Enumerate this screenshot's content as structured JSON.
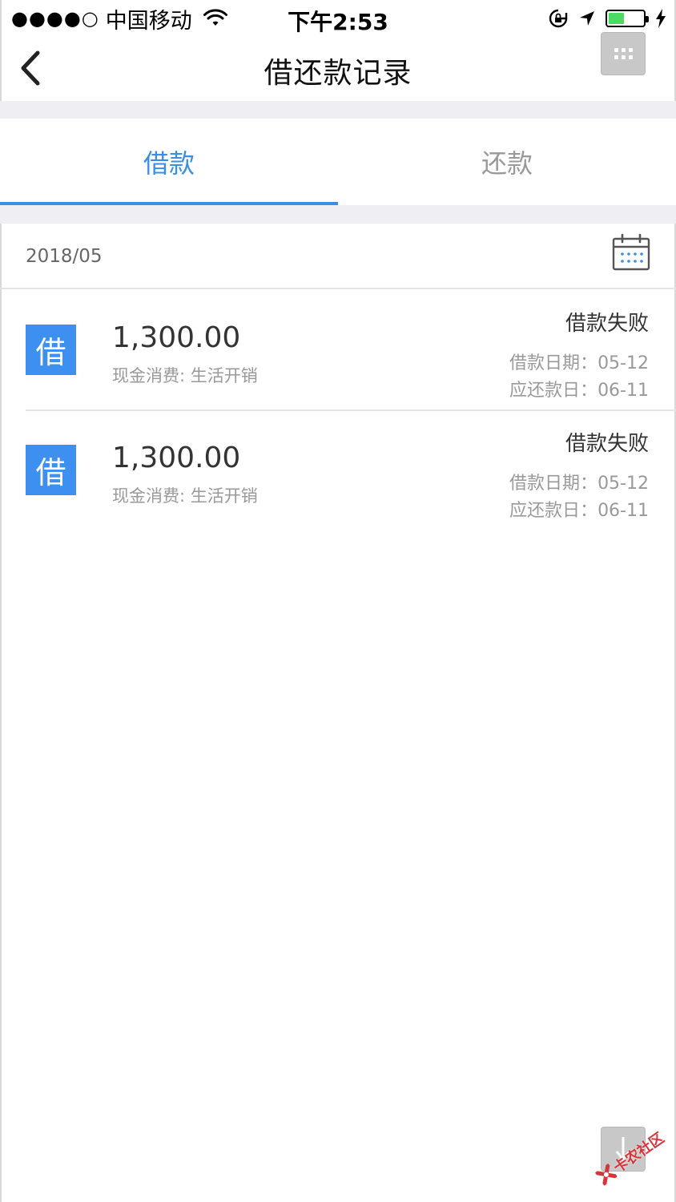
{
  "status_bar": {
    "signal": "●●●●○",
    "carrier": "中国移动",
    "time": "下午2:53",
    "battery_level": 0.45
  },
  "nav": {
    "title": "借还款记录"
  },
  "tabs": [
    {
      "label": "借款",
      "active": true
    },
    {
      "label": "还款",
      "active": false
    }
  ],
  "month": {
    "label": "2018/05"
  },
  "records": [
    {
      "badge": "借",
      "amount": "1,300.00",
      "description": "现金消费: 生活开销",
      "status": "借款失败",
      "loan_date_label": "借款日期：",
      "loan_date": "05-12",
      "due_date_label": "应还款日：",
      "due_date": "06-11"
    },
    {
      "badge": "借",
      "amount": "1,300.00",
      "description": "现金消费: 生活开销",
      "status": "借款失败",
      "loan_date_label": "借款日期：",
      "loan_date": "05-12",
      "due_date_label": "应还款日：",
      "due_date": "06-11"
    }
  ],
  "watermark": {
    "text": "卡农社区"
  },
  "colors": {
    "accent": "#3a8ee6",
    "badge": "#3d8ff0",
    "battery": "#4cd964",
    "watermark": "#d9343a"
  }
}
